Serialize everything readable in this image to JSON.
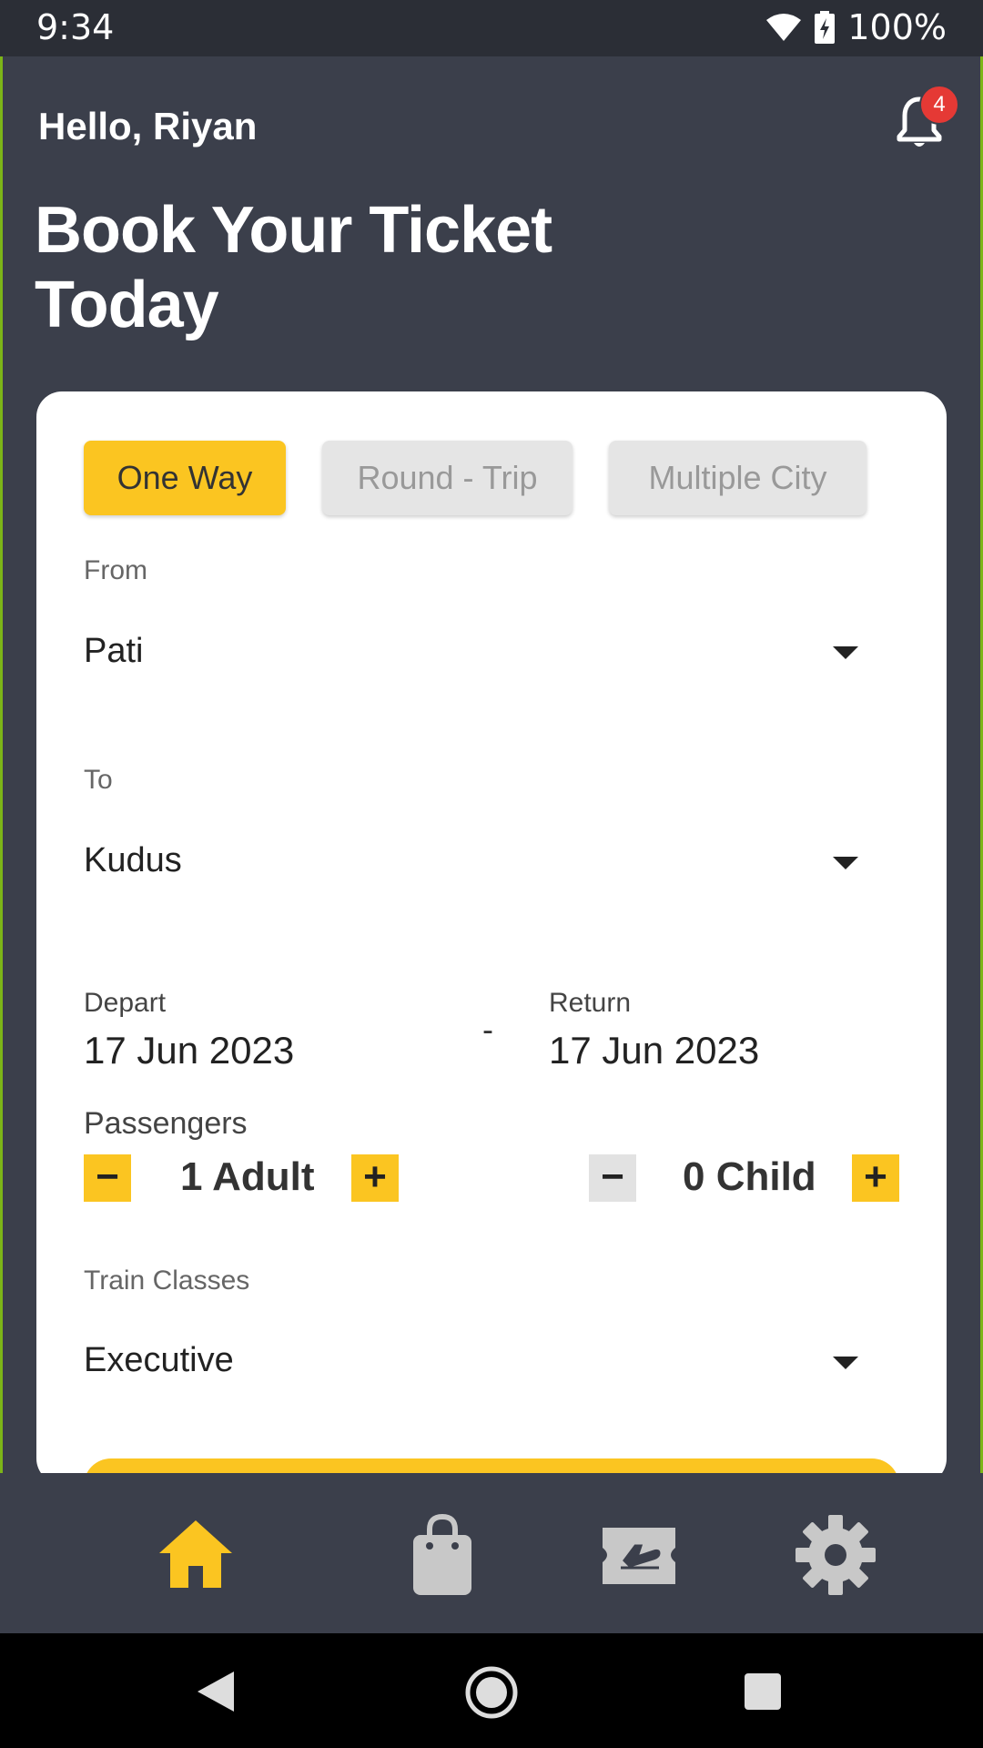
{
  "status_bar": {
    "time": "9:34",
    "battery": "100%"
  },
  "header": {
    "greeting": "Hello, Riyan",
    "notification_count": "4",
    "title": "Book Your Ticket Today"
  },
  "trip_types": [
    {
      "label": "One Way",
      "active": true
    },
    {
      "label": "Round - Trip",
      "active": false
    },
    {
      "label": "Multiple City",
      "active": false
    }
  ],
  "form": {
    "from_label": "From",
    "from_value": "Pati",
    "to_label": "To",
    "to_value": "Kudus",
    "depart_label": "Depart",
    "depart_value": "17 Jun 2023",
    "separator": "-",
    "return_label": "Return",
    "return_value": "17 Jun 2023",
    "passengers_label": "Passengers",
    "adult_count": "1 Adult",
    "child_count": "0 Child",
    "class_label": "Train Classes",
    "class_value": "Executive"
  },
  "bottom_nav": [
    {
      "icon": "home-icon",
      "active": true
    },
    {
      "icon": "shopping-bag-icon",
      "active": false
    },
    {
      "icon": "ticket-icon",
      "active": false
    },
    {
      "icon": "gear-icon",
      "active": false
    }
  ],
  "colors": {
    "accent": "#fbc521",
    "background": "#3b3f4b",
    "card": "#ffffff",
    "badge": "#e53935"
  }
}
